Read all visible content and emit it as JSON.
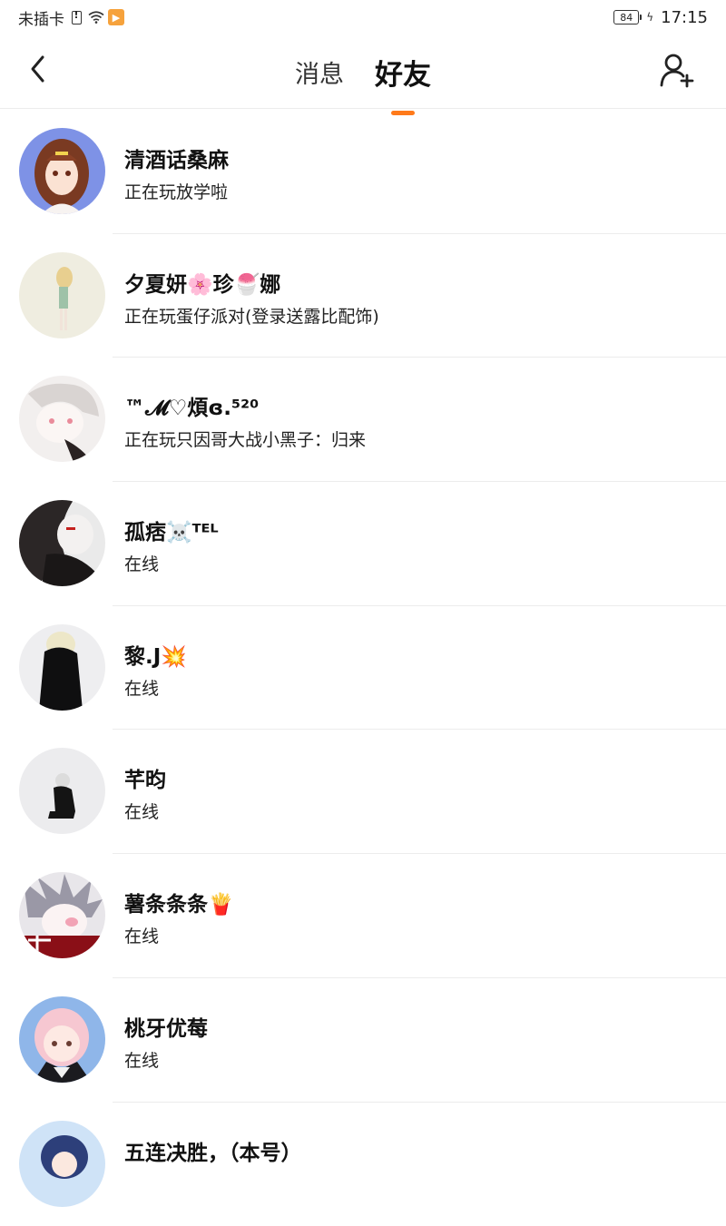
{
  "status_bar": {
    "carrier": "未插卡",
    "battery": "84",
    "time": "17:15"
  },
  "header": {
    "tabs": [
      {
        "label": "消息",
        "active": false
      },
      {
        "label": "好友",
        "active": true
      }
    ],
    "accent_color": "#ff7a1a"
  },
  "friends": [
    {
      "name": "清酒话桑麻",
      "status": "正在玩放学啦"
    },
    {
      "name": "夕夏妍🌸珍🍧娜",
      "status": "正在玩蛋仔派对(登录送露比配饰)"
    },
    {
      "name": "™𝓜♡煩ɞ.⁵²⁰",
      "status": "正在玩只因哥大战小黑子：归来"
    },
    {
      "name": "孤痞☠️ᵀᴱᴸ",
      "status": "在线"
    },
    {
      "name": "黎.J💥",
      "status": "在线"
    },
    {
      "name": "芊昀",
      "status": "在线"
    },
    {
      "name": "薯条条条🍟",
      "status": "在线"
    },
    {
      "name": "桃牙优莓",
      "status": "在线"
    },
    {
      "name": "五连决胜，（本号）",
      "status": ""
    }
  ]
}
